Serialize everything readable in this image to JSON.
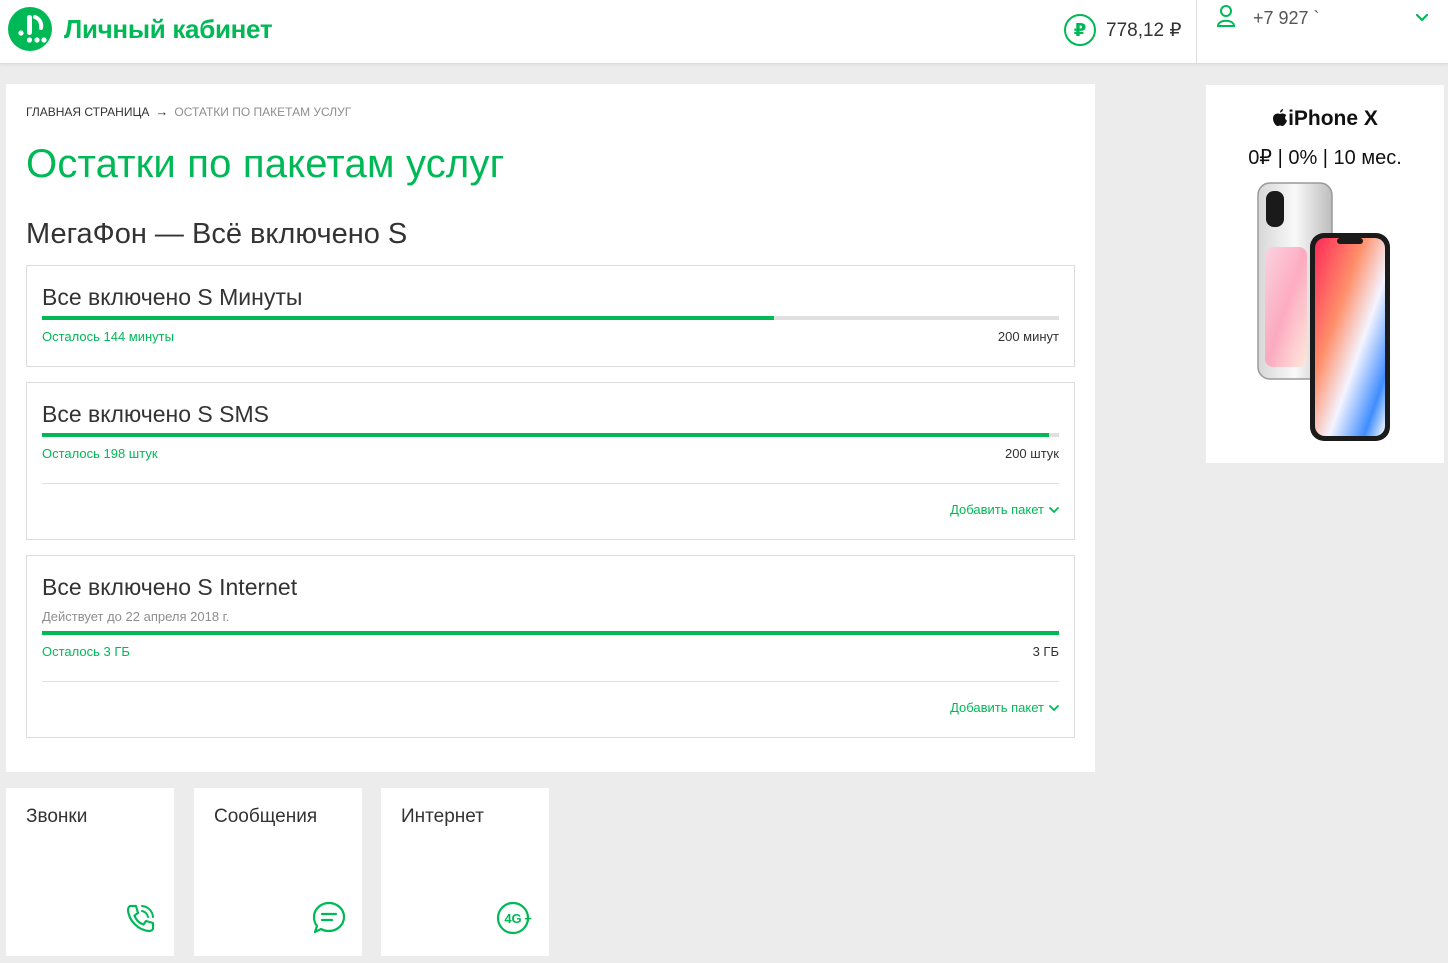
{
  "header": {
    "title": "Личный кабинет",
    "balance": "778,12 ₽",
    "currency_icon_glyph": "₽",
    "phone": "+7 927 `",
    "icons": [
      "megafon-logo-icon",
      "ruble-icon",
      "user-icon",
      "chevron-down-icon"
    ]
  },
  "breadcrumb": {
    "home": "Главная страница",
    "separator": "→",
    "current": "Остатки по пакетам услуг"
  },
  "page": {
    "title": "Остатки по пакетам услуг",
    "tariff": "МегаФон — Всё включено S"
  },
  "packages": [
    {
      "title": "Все включено S Минуты",
      "subtitle": "",
      "remaining_label": "Осталось 144 минуты",
      "total_label": "200 минут",
      "fill_fraction": 0.72,
      "add_label": ""
    },
    {
      "title": "Все включено S SMS",
      "subtitle": "",
      "remaining_label": "Осталось 198 штук",
      "total_label": "200 штук",
      "fill_fraction": 0.99,
      "add_label": "Добавить пакет"
    },
    {
      "title": "Все включено S Internet",
      "subtitle": "Действует до 22 апреля 2018 г.",
      "remaining_label": "Осталось 3 ГБ",
      "total_label": "3 ГБ",
      "fill_fraction": 1.0,
      "add_label": "Добавить пакет"
    }
  ],
  "ad": {
    "title": "iPhone X",
    "terms": "0₽ | 0% | 10 мес."
  },
  "tiles": [
    {
      "label": "Звонки",
      "icon": "phone-call-icon"
    },
    {
      "label": "Сообщения",
      "icon": "chat-bubble-icon"
    },
    {
      "label": "Интернет",
      "icon": "4g-plus-icon"
    }
  ],
  "colors": {
    "brand_green": "#00b956",
    "text": "#333333",
    "muted": "#8e8e8e",
    "background": "#ececec"
  }
}
